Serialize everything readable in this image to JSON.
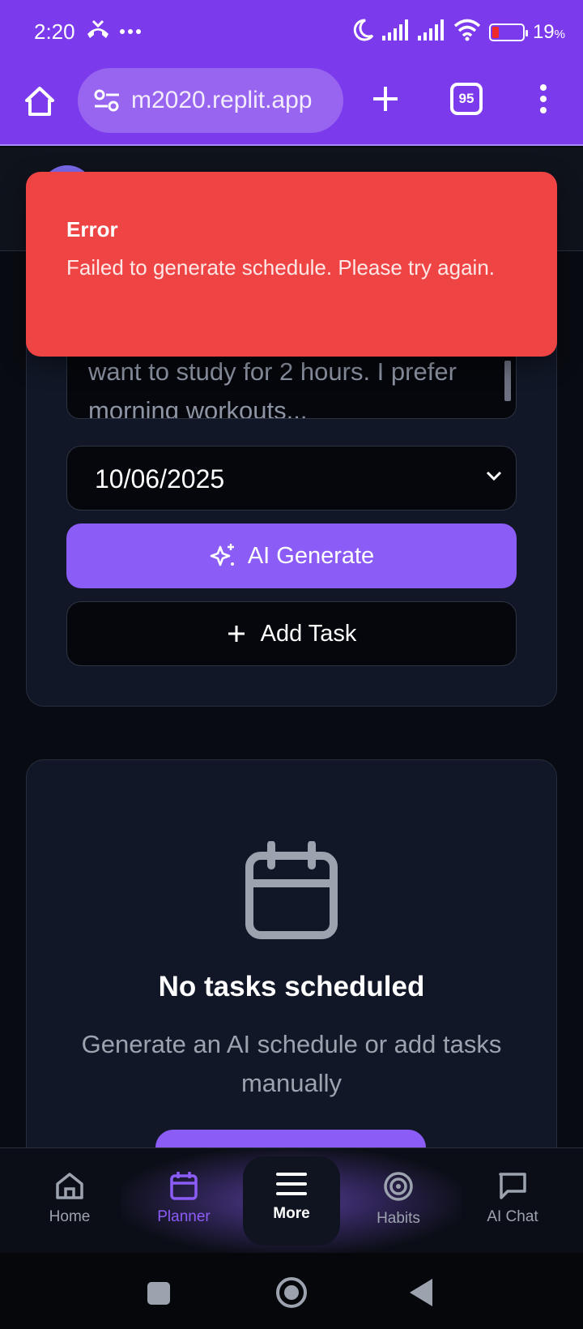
{
  "status_bar": {
    "time": "2:20",
    "battery_percent": "19",
    "battery_unit": "%",
    "icons": [
      "missed-call-icon",
      "more-dots-icon",
      "moon-icon",
      "signal-icon",
      "signal-icon",
      "wifi-icon",
      "battery-icon"
    ]
  },
  "browser": {
    "url": "m2020.replit.app",
    "tab_count": "95"
  },
  "form": {
    "textarea_text": "want to study for 2 hours. I prefer morning workouts...",
    "date_value": "10/06/2025",
    "ai_generate_label": "AI Generate",
    "add_task_label": "Add Task"
  },
  "empty_state": {
    "title": "No tasks scheduled",
    "subtitle": "Generate an AI schedule or add tasks manually"
  },
  "bottom_nav": {
    "items": [
      {
        "label": "Home",
        "icon": "home-icon"
      },
      {
        "label": "Planner",
        "icon": "calendar-icon",
        "active": true
      },
      {
        "label": "More",
        "icon": "hamburger-icon"
      },
      {
        "label": "Habits",
        "icon": "target-icon"
      },
      {
        "label": "AI Chat",
        "icon": "chat-icon"
      }
    ]
  },
  "toast": {
    "title": "Error",
    "message": "Failed to generate schedule. Please try again."
  },
  "colors": {
    "accent": "#8b5cf6",
    "status_bar": "#7c3aed",
    "error": "#ef4444",
    "background": "#090b12",
    "card": "#111726"
  }
}
